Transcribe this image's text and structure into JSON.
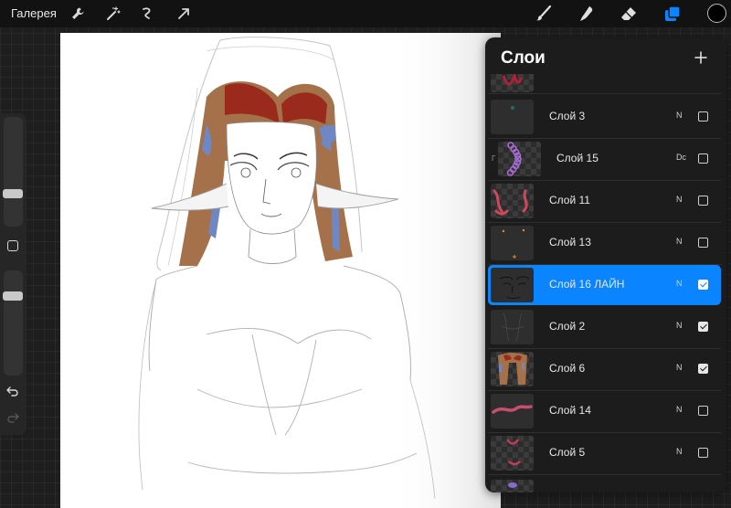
{
  "toolbar": {
    "gallery_label": "Галерея",
    "left_tools": [
      "wrench-icon",
      "magic-wand-icon",
      "selection-icon",
      "transform-arrow-icon"
    ],
    "right_tools": [
      "brush-icon",
      "smudge-icon",
      "eraser-icon",
      "layers-icon"
    ],
    "active_tool": "layers-icon",
    "active_color": "#000000",
    "accent_color": "#0a84ff"
  },
  "sidebar": {
    "brush_size_level": 0.28,
    "opacity_level": 0.78,
    "icons": [
      "modify-square-icon",
      "undo-icon",
      "redo-icon"
    ]
  },
  "layers_panel": {
    "title": "Слои",
    "add_icon": "plus-icon",
    "layers": [
      {
        "name": "Слой 3",
        "blend": "N",
        "visible": false,
        "thumb": "dark-spot"
      },
      {
        "name": "Слой 15",
        "blend": "Dc",
        "visible": false,
        "thumb": "purple-beads",
        "clipped": true,
        "clip_mark": "Γ"
      },
      {
        "name": "Слой 11",
        "blend": "N",
        "visible": false,
        "thumb": "pink-tentacles"
      },
      {
        "name": "Слой 13",
        "blend": "N",
        "visible": false,
        "thumb": "sparse-orange"
      },
      {
        "name": "Слой 16 ЛАЙН",
        "blend": "N",
        "visible": true,
        "thumb": "line-art",
        "selected": true
      },
      {
        "name": "Слой 2",
        "blend": "N",
        "visible": true,
        "thumb": "sketch"
      },
      {
        "name": "Слой 6",
        "blend": "N",
        "visible": true,
        "thumb": "hair-colors"
      },
      {
        "name": "Слой 14",
        "blend": "N",
        "visible": false,
        "thumb": "pink-stroke"
      },
      {
        "name": "Слой 5",
        "blend": "N",
        "visible": false,
        "thumb": "pink-small"
      }
    ]
  }
}
